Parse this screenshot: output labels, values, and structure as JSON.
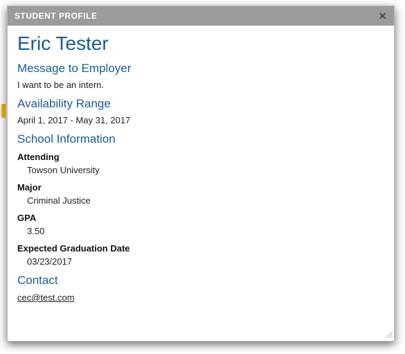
{
  "titlebar": {
    "title": "STUDENT PROFILE"
  },
  "student": {
    "name": "Eric Tester"
  },
  "message": {
    "heading": "Message to Employer",
    "text": "I want to be an intern."
  },
  "availability": {
    "heading": "Availability Range",
    "range": "April 1, 2017 - May 31, 2017"
  },
  "school": {
    "heading": "School Information",
    "attending_label": "Attending",
    "attending_value": "Towson University",
    "major_label": "Major",
    "major_value": "Criminal Justice",
    "gpa_label": "GPA",
    "gpa_value": "3.50",
    "grad_label": "Expected Graduation Date",
    "grad_value": "03/23/2017"
  },
  "contact": {
    "heading": "Contact",
    "email": "cec@test.com"
  }
}
